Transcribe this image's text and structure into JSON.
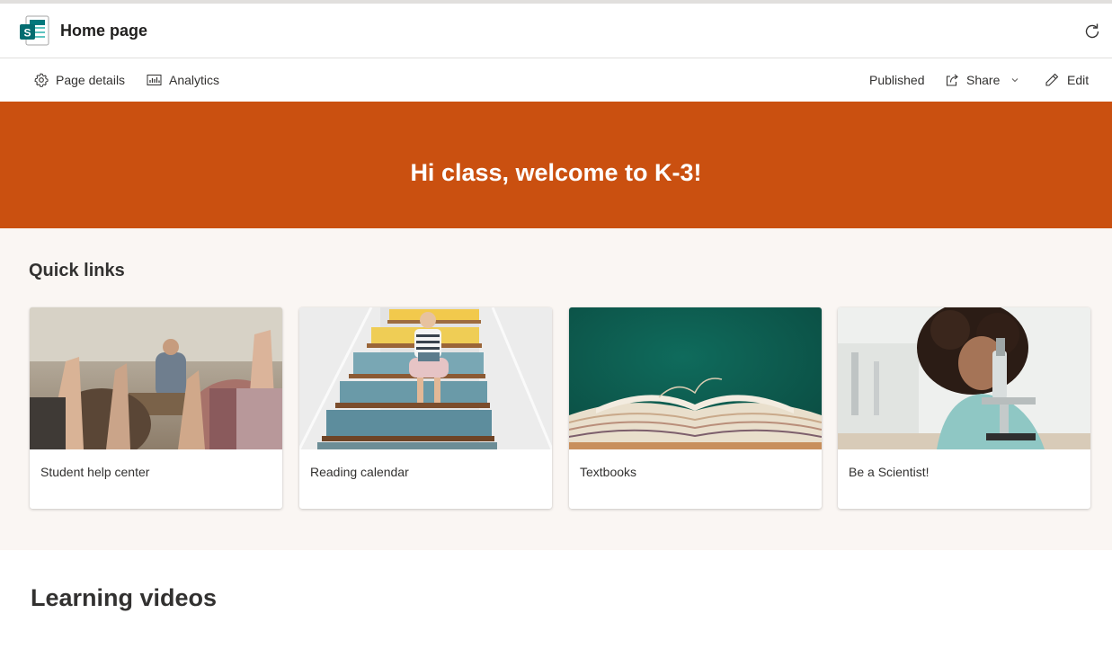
{
  "header": {
    "page_title": "Home page"
  },
  "command_bar": {
    "page_details": "Page details",
    "analytics": "Analytics",
    "status": "Published",
    "share": "Share",
    "edit": "Edit"
  },
  "hero": {
    "title": "Hi class, welcome to K-3!",
    "background_color": "#ca5010"
  },
  "quick_links": {
    "heading": "Quick links",
    "items": [
      {
        "label": "Student help center",
        "image": "classroom-raised-hands"
      },
      {
        "label": "Reading calendar",
        "image": "child-reading-on-stairs"
      },
      {
        "label": "Textbooks",
        "image": "open-books-on-green"
      },
      {
        "label": "Be a Scientist!",
        "image": "girl-with-microscope"
      }
    ]
  },
  "learning_videos": {
    "heading": "Learning videos"
  },
  "colors": {
    "accent": "#ca5010",
    "section_bg": "#faf6f3",
    "sharepoint_teal": "#038387"
  }
}
